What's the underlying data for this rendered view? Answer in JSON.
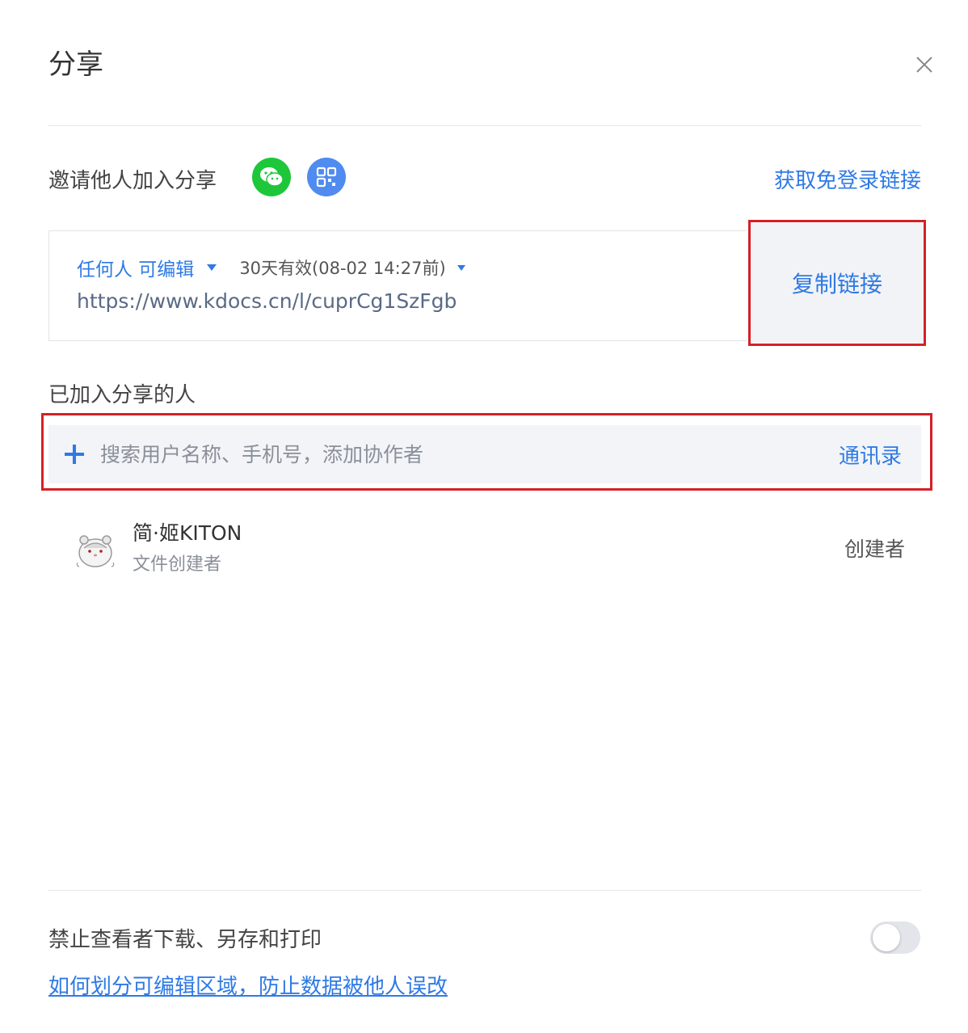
{
  "dialog": {
    "title": "分享",
    "close_icon": "close-icon"
  },
  "invite": {
    "label": "邀请他人加入分享",
    "wechat_icon": "wechat-icon",
    "qrcode_icon": "qrcode-icon",
    "get_link_label": "获取免登录链接"
  },
  "link": {
    "permission": "任何人 可编辑",
    "validity": "30天有效(08-02 14:27前)",
    "url": "https://www.kdocs.cn/l/cuprCg1SzFgb",
    "copy_label": "复制链接"
  },
  "members": {
    "section_label": "已加入分享的人",
    "search_placeholder": "搜索用户名称、手机号，添加协作者",
    "contacts_label": "通讯录",
    "list": [
      {
        "name": "简·姬KITON",
        "subtitle": "文件创建者",
        "role": "创建者"
      }
    ]
  },
  "footer": {
    "restrict_label": "禁止查看者下载、另存和打印",
    "restrict_enabled": false,
    "help_link": "如何划分可编辑区域，防止数据被他人误改"
  },
  "colors": {
    "accent": "#2f7ae5",
    "highlight": "#d52026",
    "wechat": "#1ec73a",
    "qrcode": "#4f8bf0"
  }
}
